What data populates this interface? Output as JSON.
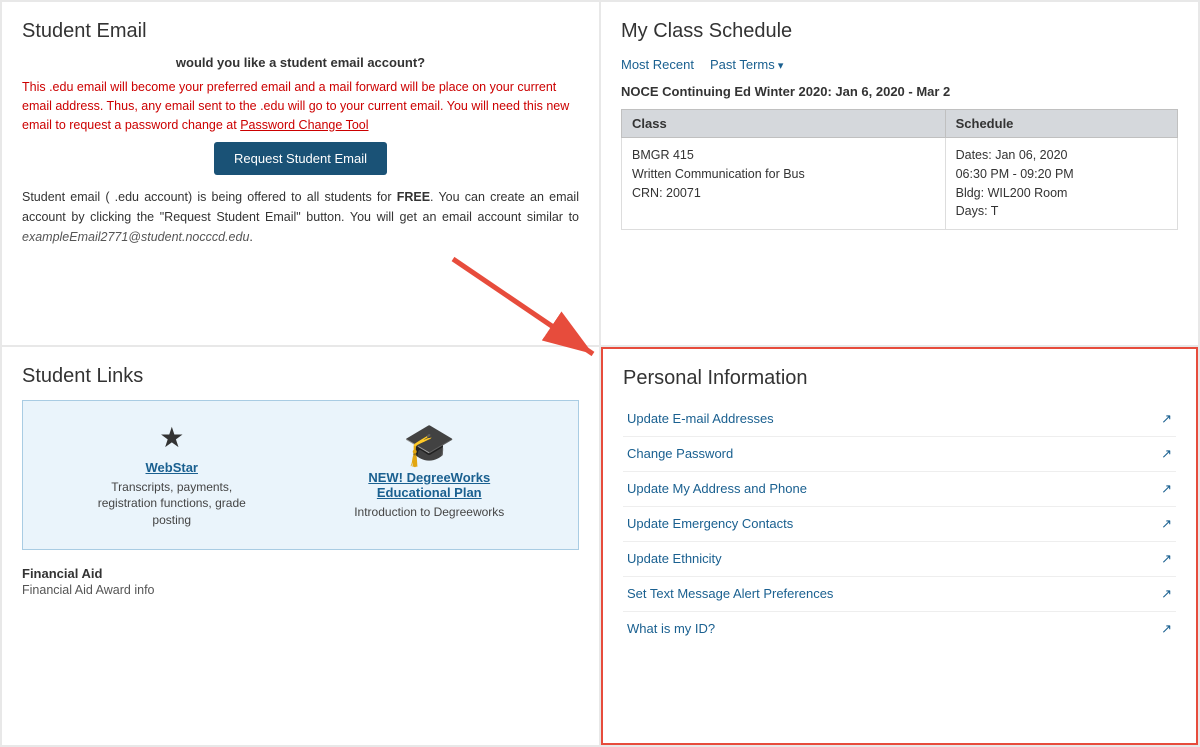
{
  "studentEmail": {
    "title": "Student Email",
    "question": "would you like a student email account?",
    "warning": "This  .edu email will become your preferred email and a mail forward will be place on your current email address. Thus, any email sent to the .edu will go to your current email. You will need this new email to request a password change at ",
    "passwordLink": "Password Change Tool",
    "buttonLabel": "Request Student Email",
    "infoText": "Student email ( .edu account) is being offered to all students for ",
    "infoFree": "FREE",
    "infoText2": ". You can create an email account by clicking the \"Request Student Email\" button. You will get an email account similar to ",
    "emailExample": "exampleEmail2771@student.nocccd.edu",
    "infoText3": "."
  },
  "classSchedule": {
    "title": "My Class Schedule",
    "tabMostRecent": "Most Recent",
    "tabPastTerms": "Past Terms",
    "termLabel": "NOCE Continuing Ed Winter 2020: Jan 6, 2020 - Mar 2",
    "tableHeaders": [
      "Class",
      "Schedule"
    ],
    "rows": [
      {
        "class": "BMGR 415\nWritten Communication for Bus\nCRN: 20071",
        "schedule": "Dates: Jan 06, 2020\n06:30 PM - 09:20 PM\nBldg: WIL200 Room\nDays: T"
      }
    ]
  },
  "studentLinks": {
    "title": "Student Links",
    "webstar": {
      "icon": "★",
      "title": "WebStar",
      "description": "Transcripts, payments, registration functions, grade posting"
    },
    "degreeworks": {
      "title": "NEW! DegreeWorks Educational Plan",
      "description": "Introduction to Degreeworks"
    },
    "financialAid": {
      "title": "Financial Aid",
      "description": "Financial Aid Award info"
    }
  },
  "personalInfo": {
    "title": "Personal Information",
    "items": [
      {
        "label": "Update E-mail Addresses"
      },
      {
        "label": "Change Password"
      },
      {
        "label": "Update My Address and Phone"
      },
      {
        "label": "Update Emergency Contacts"
      },
      {
        "label": "Update Ethnicity"
      },
      {
        "label": "Set Text Message Alert Preferences"
      },
      {
        "label": "What is my ID?"
      }
    ]
  }
}
